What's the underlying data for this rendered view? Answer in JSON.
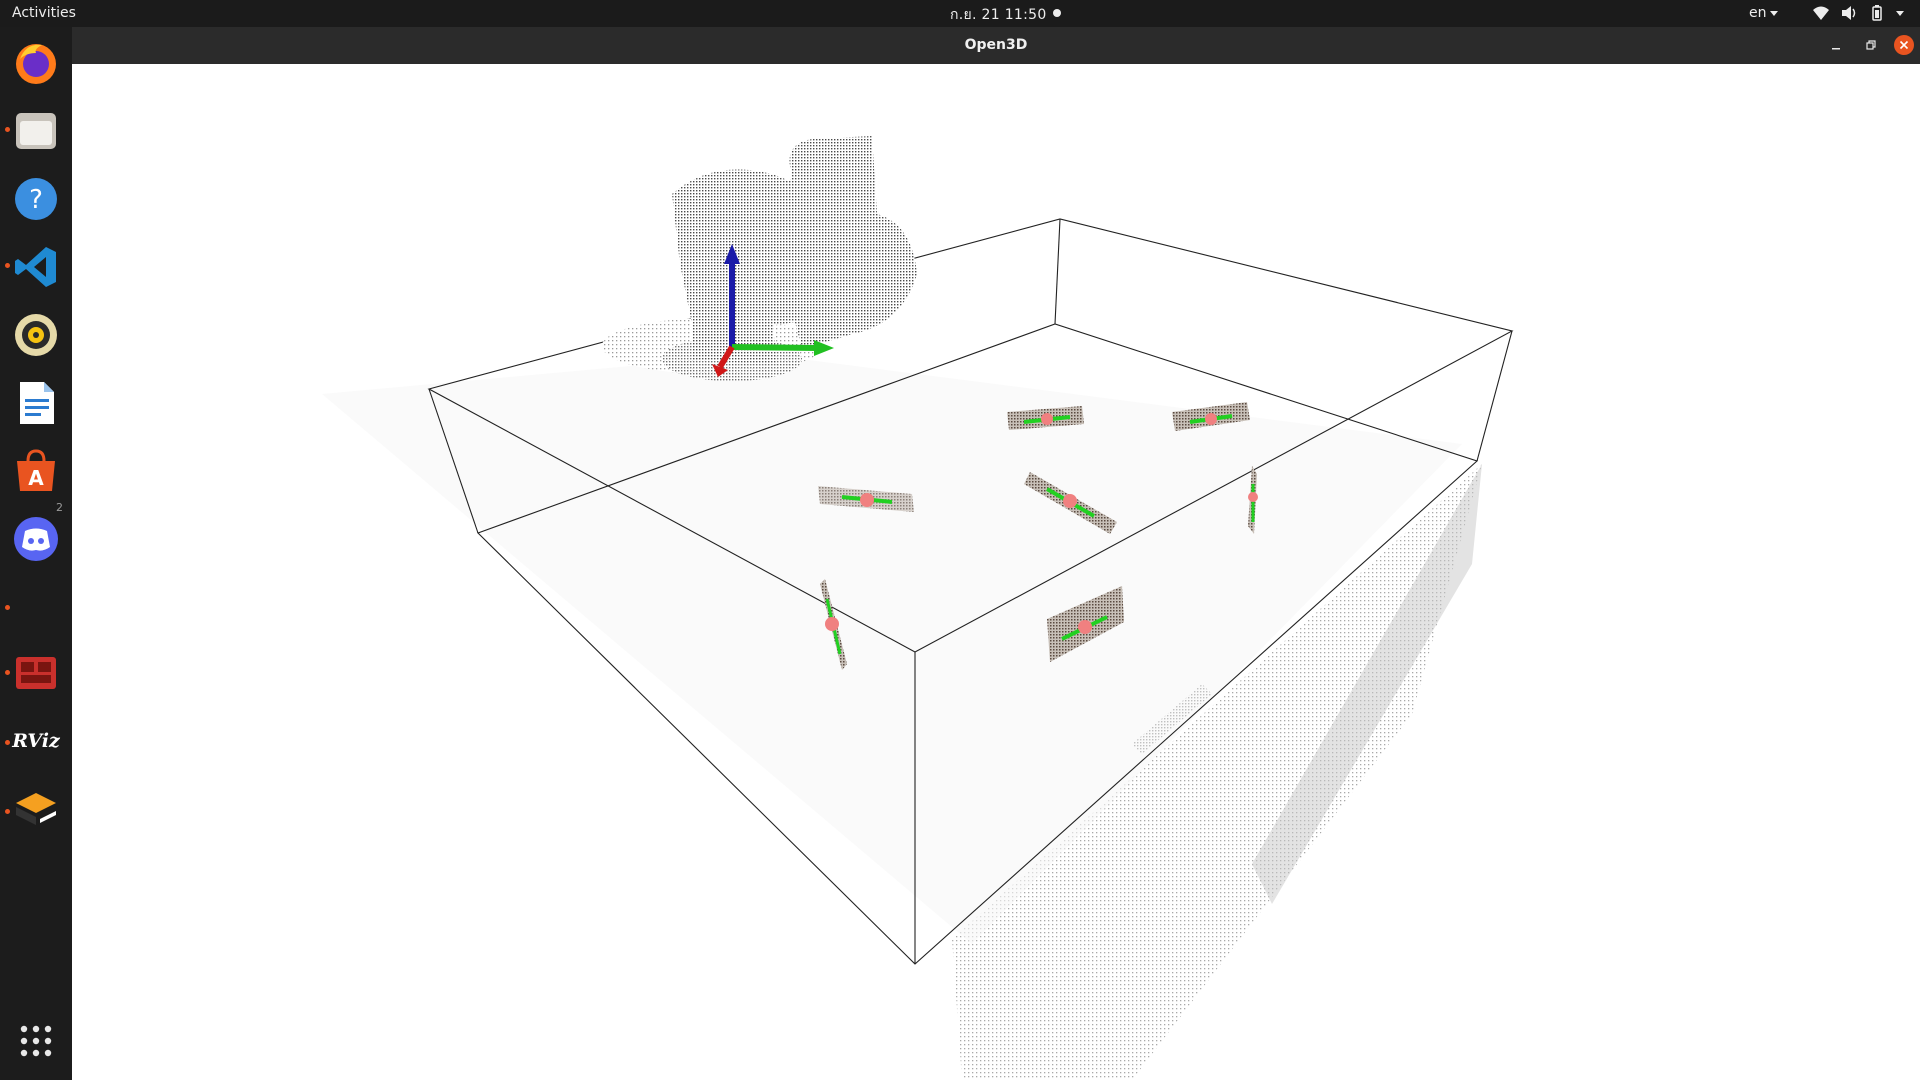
{
  "topbar": {
    "activities_label": "Activities",
    "clock": "ก.ย. 21  11:50",
    "language": "en"
  },
  "dock": {
    "items": [
      {
        "name": "firefox-icon"
      },
      {
        "name": "files-icon"
      },
      {
        "name": "help-icon"
      },
      {
        "name": "vscode-icon"
      },
      {
        "name": "rhythmbox-icon"
      },
      {
        "name": "libreoffice-writer-icon"
      },
      {
        "name": "software-center-icon"
      },
      {
        "name": "discord-icon"
      },
      {
        "name": "remote-desktop-icon"
      },
      {
        "name": "rviz-icon",
        "label": "RViz"
      },
      {
        "name": "ros-stack-icon"
      },
      {
        "name": "show-apps-icon"
      }
    ],
    "workspace_badge": "2"
  },
  "window": {
    "title": "Open3D"
  },
  "colors": {
    "accent": "#e95420",
    "axis_x": "#e01010",
    "axis_y": "#10c010",
    "axis_z": "#1010c0",
    "grasp_center": "#f08080",
    "grasp_axis": "#20d020"
  }
}
